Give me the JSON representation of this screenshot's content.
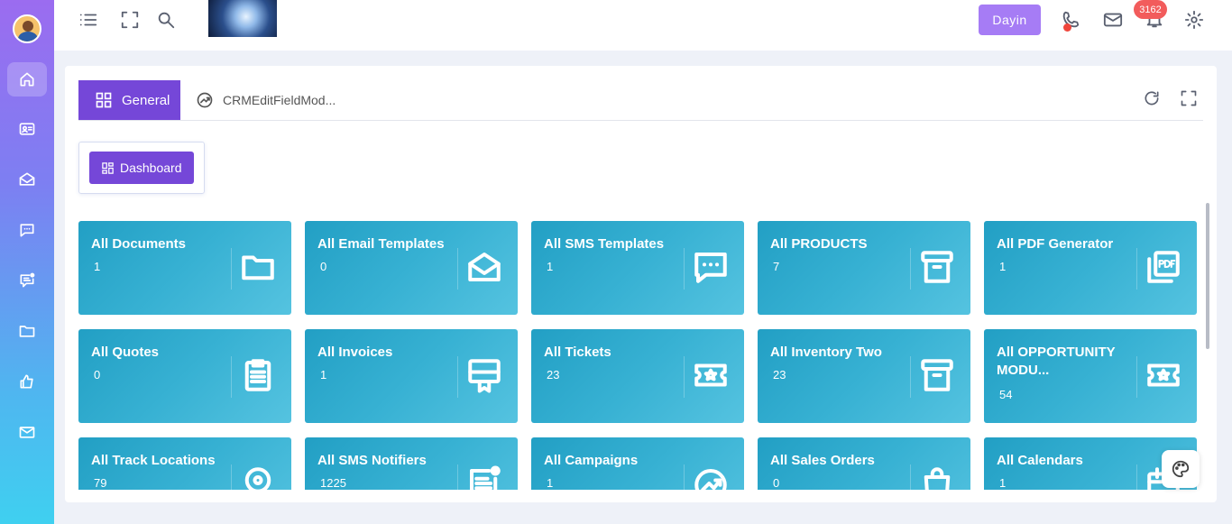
{
  "topbar": {
    "user_button": "Dayin",
    "notification_count": "3162",
    "thumbnail_alt": "anime-thumbnail",
    "icons": [
      "menu-icon",
      "fullscreen-icon",
      "search-icon",
      "phone-icon",
      "mail-icon",
      "bell-icon",
      "gear-icon"
    ]
  },
  "sidebar": {
    "items": [
      {
        "name": "home-icon",
        "active": true
      },
      {
        "name": "contact-card-icon"
      },
      {
        "name": "envelope-open-icon"
      },
      {
        "name": "chat-icon"
      },
      {
        "name": "message-notify-icon"
      },
      {
        "name": "folder-icon"
      },
      {
        "name": "thumbs-up-icon"
      },
      {
        "name": "mail-icon"
      }
    ]
  },
  "tabs": {
    "general": "General",
    "crm": "CRMEditFieldMod..."
  },
  "dashboard_button": "Dashboard",
  "cards": [
    {
      "title": "All Documents",
      "count": "1",
      "icon": "folder-icon"
    },
    {
      "title": "All Email Templates",
      "count": "0",
      "icon": "envelope-open-icon"
    },
    {
      "title": "All SMS Templates",
      "count": "1",
      "icon": "sms-icon"
    },
    {
      "title": "All PRODUCTS",
      "count": "7",
      "icon": "archive-icon"
    },
    {
      "title": "All PDF Generator",
      "count": "1",
      "icon": "pdf-icon"
    },
    {
      "title": "All Quotes",
      "count": "0",
      "icon": "clipboard-icon"
    },
    {
      "title": "All Invoices",
      "count": "1",
      "icon": "invoice-icon"
    },
    {
      "title": "All Tickets",
      "count": "23",
      "icon": "ticket-icon"
    },
    {
      "title": "All Inventory Two",
      "count": "23",
      "icon": "archive-icon"
    },
    {
      "title": "All OPPORTUNITY MODU...",
      "count": "54",
      "icon": "ticket-icon"
    },
    {
      "title": "All Track Locations",
      "count": "79",
      "icon": "location-icon"
    },
    {
      "title": "All SMS Notifiers",
      "count": "1225",
      "icon": "notifier-icon"
    },
    {
      "title": "All Campaigns",
      "count": "1",
      "icon": "trend-icon"
    },
    {
      "title": "All Sales Orders",
      "count": "0",
      "icon": "shopping-bag-icon"
    },
    {
      "title": "All Calendars",
      "count": "1",
      "icon": "calendar-icon"
    }
  ]
}
